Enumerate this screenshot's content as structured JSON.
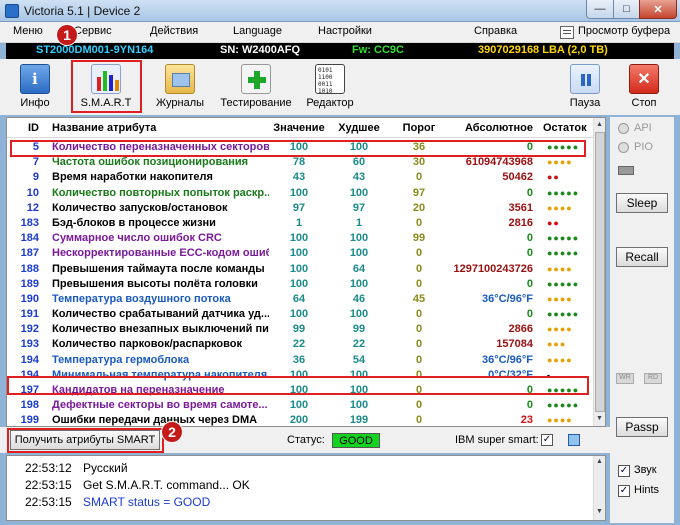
{
  "window": {
    "title": "Victoria 5.1 | Device 2",
    "min": "—",
    "max": "□",
    "close": "✕"
  },
  "menu": [
    "Меню",
    "Сервис",
    "Действия",
    "Language",
    "Настройки",
    "Справка"
  ],
  "buffer_view": "Просмотр буфера",
  "infobar": {
    "model": "ST2000DM001-9YN164",
    "sn": "SN: W2400AFQ",
    "fw": "Fw: CC9C",
    "lba": "3907029168 LBA (2,0 TB)"
  },
  "toolbar": {
    "info": "Инфо",
    "smart": "S.M.A.R.T",
    "journals": "Журналы",
    "testing": "Тестирование",
    "editor": "Редактор",
    "pause": "Пауза",
    "stop": "Стоп"
  },
  "badges": {
    "one": "1",
    "two": "2"
  },
  "table": {
    "headers": [
      "ID",
      "Название атрибута",
      "Значение",
      "Худшее",
      "Порог",
      "Абсолютное",
      "Остаток"
    ],
    "rows": [
      {
        "id": "5",
        "name": "Количество переназначенных секторов",
        "val": "100",
        "worst": "100",
        "thr": "36",
        "raw": "0",
        "st": "●●●●●",
        "nc": "#7a1a9a",
        "sc": "#1a8a1a",
        "rc": "#1a8a1a"
      },
      {
        "id": "7",
        "name": "Частота ошибок позиционирования",
        "val": "78",
        "worst": "60",
        "thr": "30",
        "raw": "61094743968",
        "st": "●●●●",
        "nc": "#1a7a1a",
        "sc": "#e6a000",
        "rc": "#9a1010"
      },
      {
        "id": "9",
        "name": "Время наработки накопителя",
        "val": "43",
        "worst": "43",
        "thr": "0",
        "raw": "50462",
        "st": "●●",
        "nc": "#000000",
        "sc": "#d01010",
        "rc": "#9a1010"
      },
      {
        "id": "10",
        "name": "Количество повторных попыток раскр...",
        "val": "100",
        "worst": "100",
        "thr": "97",
        "raw": "0",
        "st": "●●●●●",
        "nc": "#1a7a1a",
        "sc": "#1a8a1a",
        "rc": "#1a8a1a"
      },
      {
        "id": "12",
        "name": "Количество запусков/остановок",
        "val": "97",
        "worst": "97",
        "thr": "20",
        "raw": "3561",
        "st": "●●●●",
        "nc": "#000000",
        "sc": "#e6a000",
        "rc": "#9a1010"
      },
      {
        "id": "183",
        "name": "Бэд-блоков в процессе жизни",
        "val": "1",
        "worst": "1",
        "thr": "0",
        "raw": "2816",
        "st": "●●",
        "nc": "#000000",
        "sc": "#d01010",
        "rc": "#9a1010"
      },
      {
        "id": "184",
        "name": "Суммарное число ошибок CRC",
        "val": "100",
        "worst": "100",
        "thr": "99",
        "raw": "0",
        "st": "●●●●●",
        "nc": "#7a1a9a",
        "sc": "#1a8a1a",
        "rc": "#1a8a1a"
      },
      {
        "id": "187",
        "name": "Нескорректированные ECC-кодом ошиб...",
        "val": "100",
        "worst": "100",
        "thr": "0",
        "raw": "0",
        "st": "●●●●●",
        "nc": "#7a1a9a",
        "sc": "#1a8a1a",
        "rc": "#1a8a1a"
      },
      {
        "id": "188",
        "name": "Превышения таймаута после команды",
        "val": "100",
        "worst": "64",
        "thr": "0",
        "raw": "1297100243726",
        "st": "●●●●",
        "nc": "#000000",
        "sc": "#e6a000",
        "rc": "#9a1010"
      },
      {
        "id": "189",
        "name": "Превышения высоты полёта головки",
        "val": "100",
        "worst": "100",
        "thr": "0",
        "raw": "0",
        "st": "●●●●●",
        "nc": "#000000",
        "sc": "#1a8a1a",
        "rc": "#1a8a1a"
      },
      {
        "id": "190",
        "name": "Температура воздушного потока",
        "val": "64",
        "worst": "46",
        "thr": "45",
        "raw": "36°C/96°F",
        "st": "●●●●",
        "nc": "#1a5ac0",
        "sc": "#e6a000",
        "rc": "#1a5ac0"
      },
      {
        "id": "191",
        "name": "Количество срабатываний датчика уд...",
        "val": "100",
        "worst": "100",
        "thr": "0",
        "raw": "0",
        "st": "●●●●●",
        "nc": "#000000",
        "sc": "#1a8a1a",
        "rc": "#1a8a1a"
      },
      {
        "id": "192",
        "name": "Количество внезапных выключений пи...",
        "val": "99",
        "worst": "99",
        "thr": "0",
        "raw": "2866",
        "st": "●●●●",
        "nc": "#000000",
        "sc": "#e6a000",
        "rc": "#9a1010"
      },
      {
        "id": "193",
        "name": "Количество парковок/распарковок",
        "val": "22",
        "worst": "22",
        "thr": "0",
        "raw": "157084",
        "st": "●●●",
        "nc": "#000000",
        "sc": "#e6a000",
        "rc": "#9a1010"
      },
      {
        "id": "194",
        "name": "Температура гермоблока",
        "val": "36",
        "worst": "54",
        "thr": "0",
        "raw": "36°C/96°F",
        "st": "●●●●",
        "nc": "#1a5ac0",
        "sc": "#e6a000",
        "rc": "#1a5ac0"
      },
      {
        "id": "194",
        "name": "Минимальная температура накопителя",
        "val": "100",
        "worst": "100",
        "thr": "0",
        "raw": "0°C/32°F",
        "st": "-",
        "nc": "#1a5ac0",
        "sc": "#000000",
        "rc": "#1a5ac0"
      },
      {
        "id": "197",
        "name": "Кандидатов на переназначение",
        "val": "100",
        "worst": "100",
        "thr": "0",
        "raw": "0",
        "st": "●●●●●",
        "nc": "#7a1a9a",
        "sc": "#1a8a1a",
        "rc": "#1a8a1a"
      },
      {
        "id": "198",
        "name": "Дефектные секторы во время самоте...",
        "val": "100",
        "worst": "100",
        "thr": "0",
        "raw": "0",
        "st": "●●●●●",
        "nc": "#7a1a9a",
        "sc": "#1a8a1a",
        "rc": "#1a8a1a"
      },
      {
        "id": "199",
        "name": "Ошибки передачи данных через DMA",
        "val": "200",
        "worst": "199",
        "thr": "0",
        "raw": "23",
        "st": "●●●●",
        "nc": "#000000",
        "sc": "#e6a000",
        "rc": "#d01010"
      }
    ]
  },
  "bottom": {
    "smart_button": "Получить атрибуты SMART",
    "status_label": "Статус:",
    "status_value": "GOOD",
    "ibm_label": "IBM super smart:"
  },
  "side": {
    "api": "API",
    "pio": "PIO",
    "sleep": "Sleep",
    "recall": "Recall",
    "wr": "WR",
    "rd": "RD",
    "passp": "Passp",
    "sound": "Звук",
    "hints": "Hints"
  },
  "log": [
    {
      "time": "22:53:12",
      "text": "Русский",
      "color": "#000000"
    },
    {
      "time": "22:53:15",
      "text": "Get S.M.A.R.T. command... OK",
      "color": "#000000"
    },
    {
      "time": "22:53:15",
      "text": "SMART status = GOOD",
      "color": "#1a3ad0"
    }
  ],
  "colors": {
    "value": "#1a8a8a",
    "worst": "#1a8a8a",
    "threshold": "#8a8a1a",
    "highlight": "#e02020",
    "status_good": "#13d321"
  }
}
